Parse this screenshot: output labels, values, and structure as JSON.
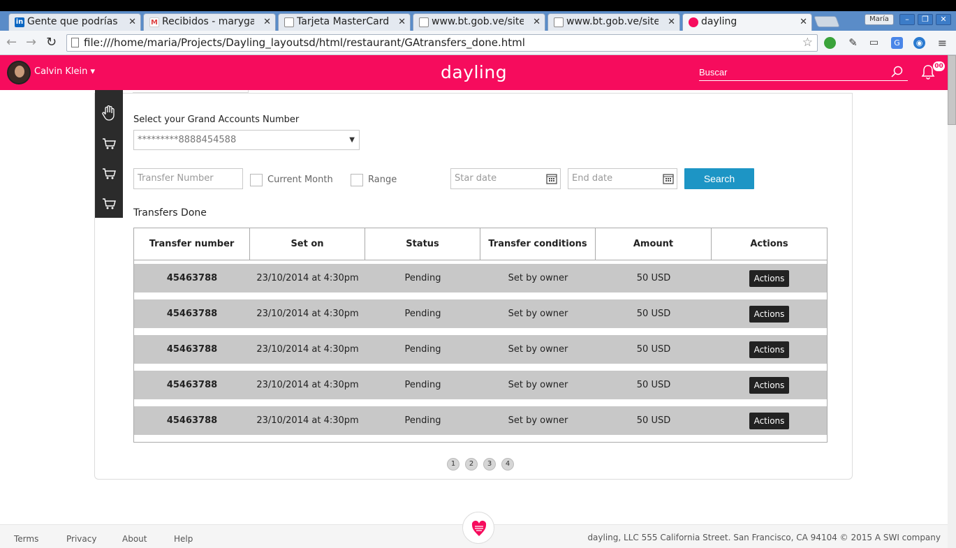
{
  "browser": {
    "tabs": [
      {
        "label": "Gente que podrías co",
        "icon": "linkedin-icon"
      },
      {
        "label": "Recibidos - marygaby",
        "icon": "gmail-icon"
      },
      {
        "label": "Tarjeta MasterCard",
        "icon": "page-icon"
      },
      {
        "label": "www.bt.gob.ve/sites",
        "icon": "page-icon"
      },
      {
        "label": "www.bt.gob.ve/sites",
        "icon": "page-icon"
      },
      {
        "label": "dayling",
        "icon": "dayling-icon"
      }
    ],
    "profile": "María",
    "url": "file:///home/maria/Projects/Dayling_layoutsd/html/restaurant/GAtransfers_done.html"
  },
  "header": {
    "username": "Calvin Klein ▾",
    "logo": "dayling",
    "search_placeholder": "Buscar",
    "notifications": "00",
    "brand_color": "#f60c5d"
  },
  "filters": {
    "account_label": "Select your Grand Accounts Number",
    "account_value": "*********8888454588",
    "transfer_number_placeholder": "Transfer Number",
    "current_month_label": "Current Month",
    "range_label": "Range",
    "start_date_placeholder": "Star date",
    "end_date_placeholder": "End date",
    "search_label": "Search",
    "accent_color": "#1d95c5"
  },
  "transfers": {
    "title": "Transfers Done",
    "columns": [
      "Transfer number",
      "Set on",
      "Status",
      "Transfer conditions",
      "Amount",
      "Actions"
    ],
    "rows": [
      {
        "number": "45463788",
        "set_on": "23/10/2014 at 4:30pm",
        "status": "Pending",
        "conditions": "Set by owner",
        "amount": "50 USD",
        "action": "Actions"
      },
      {
        "number": "45463788",
        "set_on": "23/10/2014 at 4:30pm",
        "status": "Pending",
        "conditions": "Set by owner",
        "amount": "50 USD",
        "action": "Actions"
      },
      {
        "number": "45463788",
        "set_on": "23/10/2014 at 4:30pm",
        "status": "Pending",
        "conditions": "Set by owner",
        "amount": "50 USD",
        "action": "Actions"
      },
      {
        "number": "45463788",
        "set_on": "23/10/2014 at 4:30pm",
        "status": "Pending",
        "conditions": "Set by owner",
        "amount": "50 USD",
        "action": "Actions"
      },
      {
        "number": "45463788",
        "set_on": "23/10/2014 at 4:30pm",
        "status": "Pending",
        "conditions": "Set by owner",
        "amount": "50 USD",
        "action": "Actions"
      }
    ]
  },
  "pagination": [
    "1",
    "2",
    "3",
    "4"
  ],
  "footer": {
    "links": [
      "Terms",
      "Privacy",
      "About",
      "Help"
    ],
    "copyright": "dayling, LLC 555 California Street. San Francisco, CA 94104 © 2015 A SWI company"
  }
}
